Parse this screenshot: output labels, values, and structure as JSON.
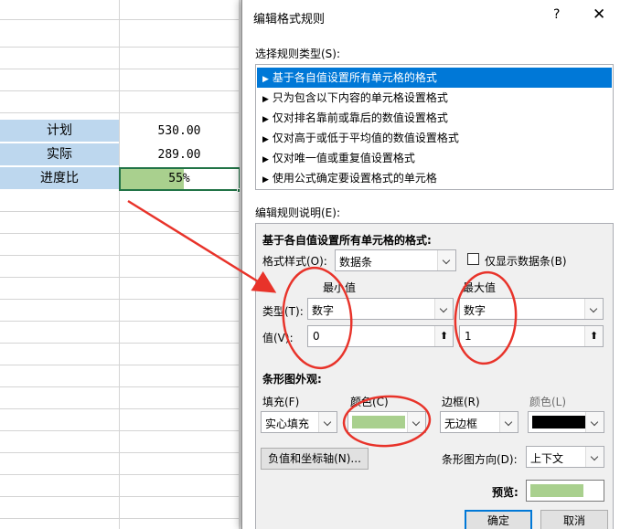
{
  "sheet": {
    "rows": [
      {
        "label": "计划",
        "value": "530.00"
      },
      {
        "label": "实际",
        "value": "289.00"
      },
      {
        "label": "进度比",
        "value": "55%"
      }
    ],
    "progress_fraction": 0.55
  },
  "dialog": {
    "title": "编辑格式规则",
    "help": "?",
    "close": "✕",
    "select_type_label": "选择规则类型(S):",
    "rule_types": [
      "基于各自值设置所有单元格的格式",
      "只为包含以下内容的单元格设置格式",
      "仅对排名靠前或靠后的数值设置格式",
      "仅对高于或低于平均值的数值设置格式",
      "仅对唯一值或重复值设置格式",
      "使用公式确定要设置格式的单元格"
    ],
    "edit_desc_label": "编辑规则说明(E):",
    "desc_heading": "基于各自值设置所有单元格的格式:",
    "format_style_label": "格式样式(O):",
    "format_style_value": "数据条",
    "show_bar_only_label": "仅显示数据条(B)",
    "min_label": "最小值",
    "max_label": "最大值",
    "type_label": "类型(T):",
    "min_type": "数字",
    "max_type": "数字",
    "value_label": "值(V):",
    "min_value": "0",
    "max_value": "1",
    "bar_appearance_label": "条形图外观:",
    "fill_label": "填充(F)",
    "fill_value": "实心填充",
    "color_label": "颜色(C)",
    "border_label": "边框(R)",
    "border_value": "无边框",
    "border_color_label": "颜色(L)",
    "neg_axis_button": "负值和坐标轴(N)...",
    "bar_direction_label": "条形图方向(D):",
    "bar_direction_value": "上下文",
    "preview_label": "预览:",
    "ok": "确定",
    "cancel": "取消"
  },
  "colors": {
    "bar_fill": "#a9d08e",
    "border_color": "#000000",
    "annotation": "#e8332a",
    "header_cells": "#bdd7ee",
    "selection": "#0078d7"
  }
}
